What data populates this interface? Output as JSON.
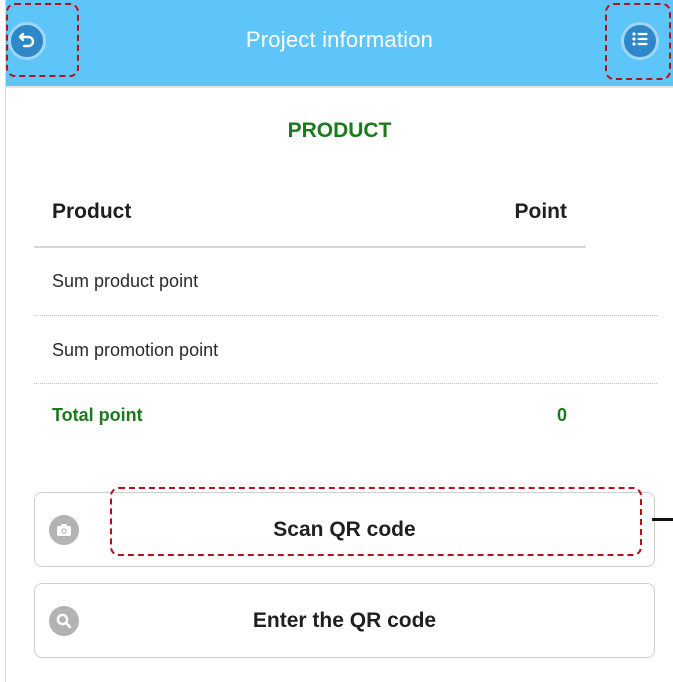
{
  "header": {
    "title": "Project information",
    "background_color": "#5ec5f8",
    "back_icon": "back-arrow-icon",
    "menu_icon": "list-menu-icon"
  },
  "product_section": {
    "title": "PRODUCT",
    "title_color": "#1b7a1b",
    "columns": [
      "Product",
      "Point"
    ],
    "rows": [
      {
        "label": "Sum product point",
        "value": ""
      },
      {
        "label": "Sum promotion point",
        "value": ""
      }
    ],
    "total": {
      "label": "Total point",
      "value": "0"
    }
  },
  "actions": {
    "scan": {
      "label": "Scan QR code",
      "icon": "camera-icon"
    },
    "enter": {
      "label": "Enter the QR code",
      "icon": "search-icon"
    }
  }
}
